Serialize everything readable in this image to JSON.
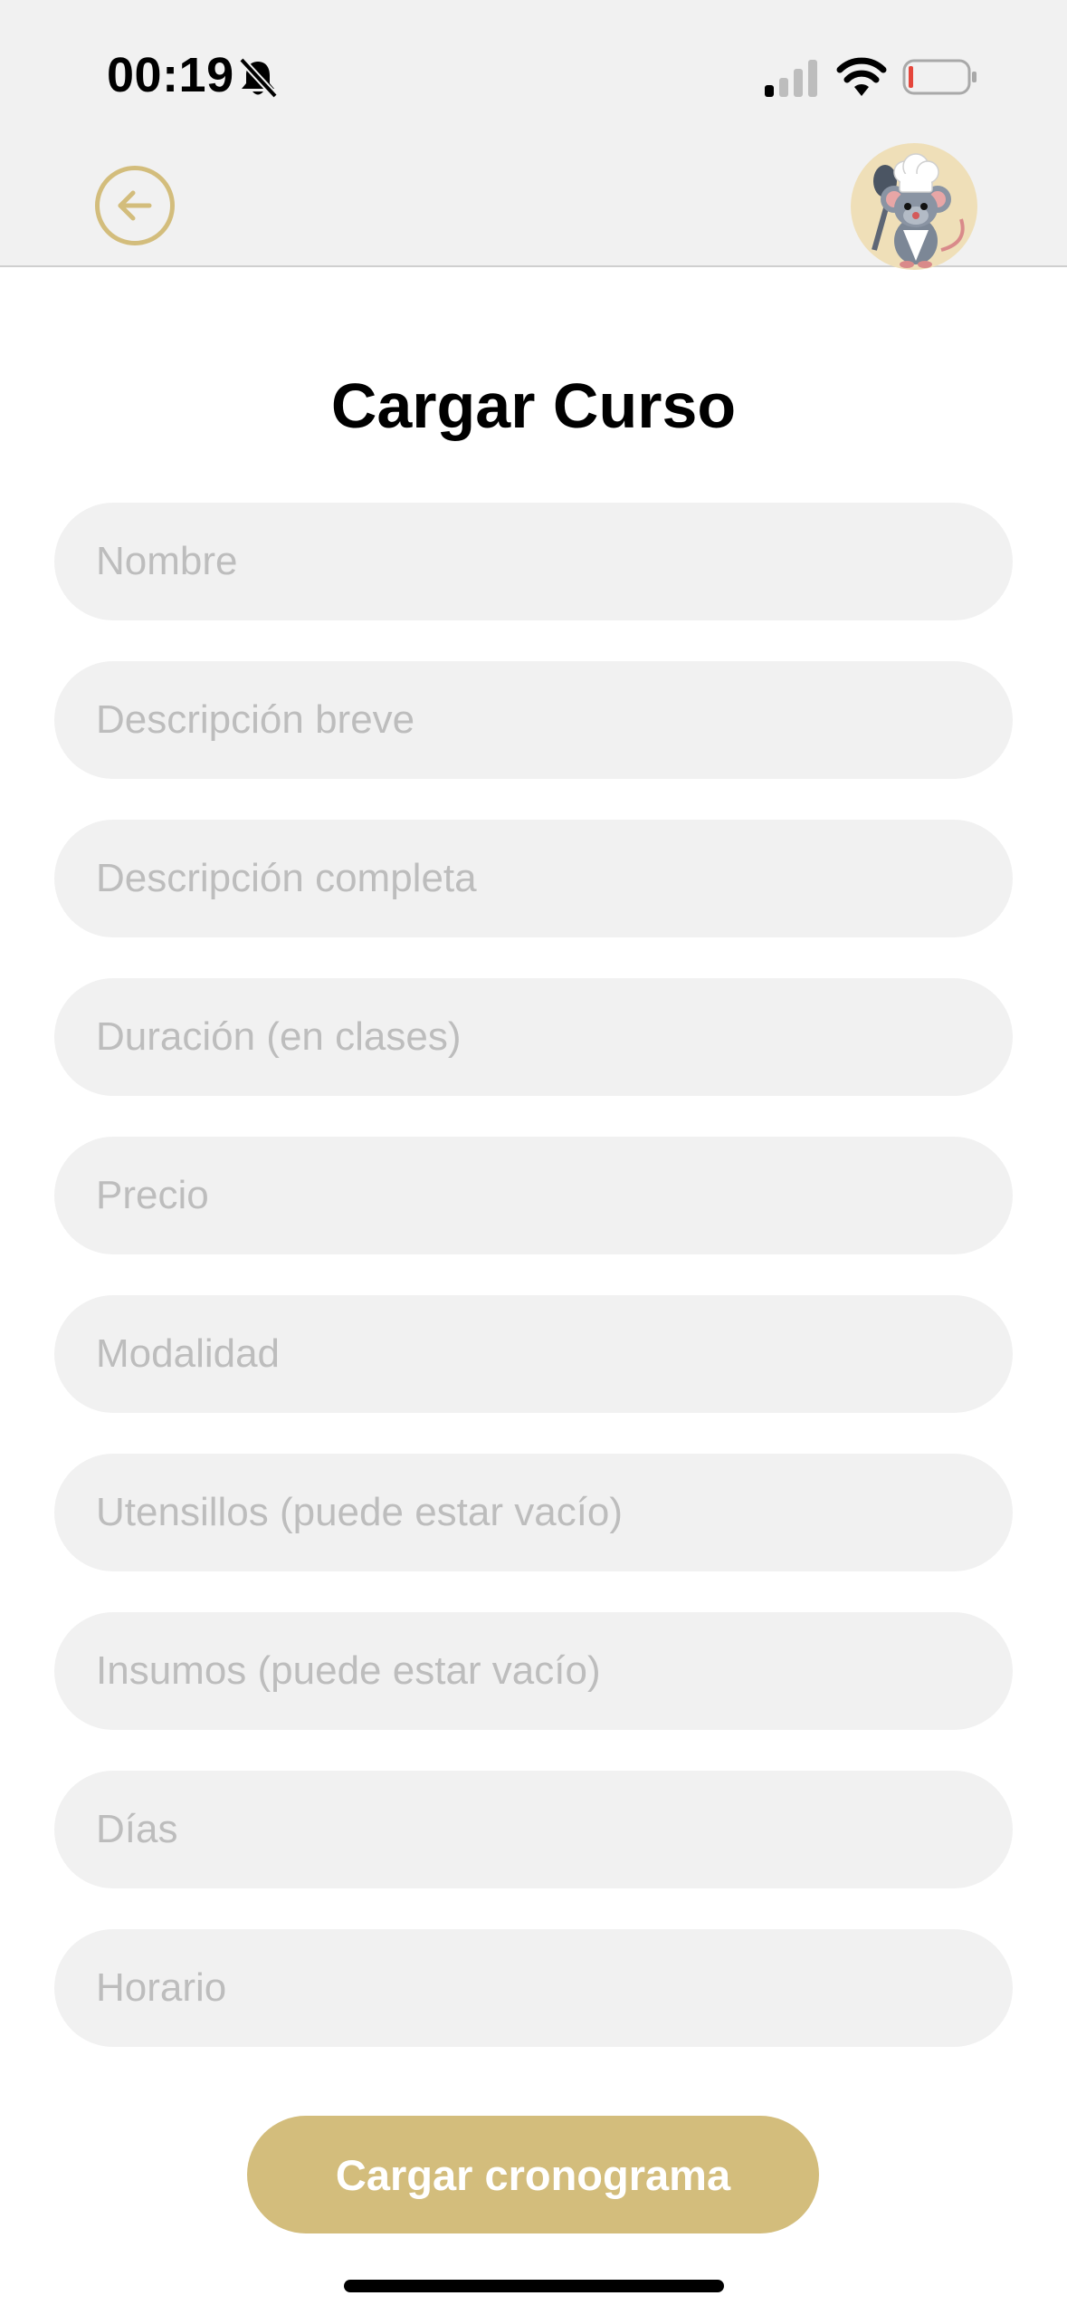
{
  "status_bar": {
    "time": "00:19"
  },
  "header": {
    "back_icon": "arrow-left-circle-icon",
    "avatar_icon": "chef-mouse-avatar"
  },
  "page": {
    "title": "Cargar Curso"
  },
  "form": {
    "fields": [
      {
        "placeholder": "Nombre",
        "value": ""
      },
      {
        "placeholder": "Descripción breve",
        "value": ""
      },
      {
        "placeholder": "Descripción completa",
        "value": ""
      },
      {
        "placeholder": "Duración (en clases)",
        "value": ""
      },
      {
        "placeholder": "Precio",
        "value": ""
      },
      {
        "placeholder": "Modalidad",
        "value": ""
      },
      {
        "placeholder": "Utensillos (puede estar vacío)",
        "value": ""
      },
      {
        "placeholder": "Insumos (puede estar vacío)",
        "value": ""
      },
      {
        "placeholder": "Días",
        "value": ""
      },
      {
        "placeholder": "Horario",
        "value": ""
      }
    ],
    "submit_label": "Cargar cronograma"
  },
  "colors": {
    "accent": "#d3bd7c",
    "field_background": "#f1f1f1",
    "placeholder": "#bdbdbd",
    "battery_low": "#e5463b"
  }
}
